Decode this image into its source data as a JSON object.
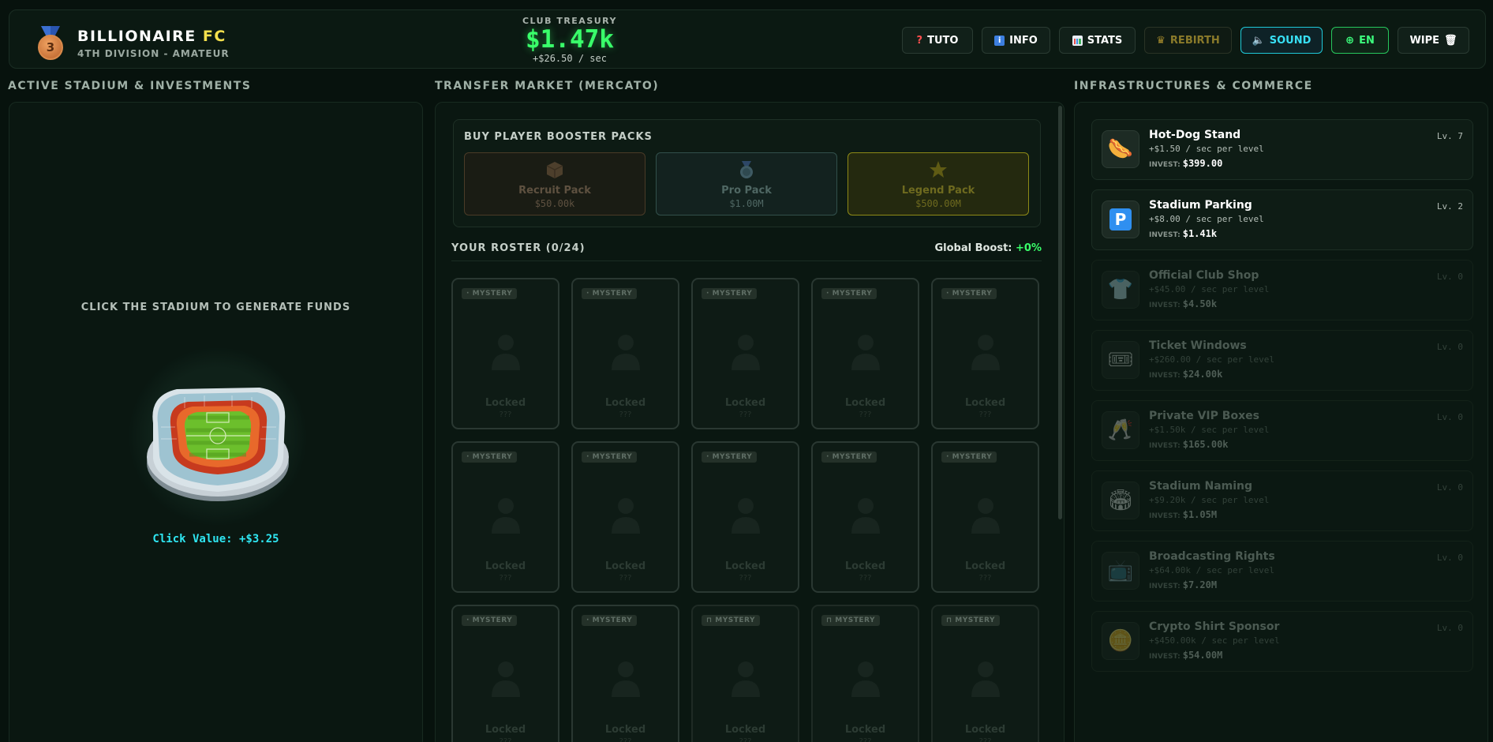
{
  "header": {
    "medal_number": "3",
    "title_part1": "BILLIONAIRE",
    "title_part2": "FC",
    "subtitle": "4TH DIVISION - AMATEUR",
    "treasury_label": "CLUB TREASURY",
    "treasury_value": "$1.47k",
    "treasury_rate": "+$26.50 / sec",
    "buttons": {
      "tuto": "TUTO",
      "info": "INFO",
      "stats": "STATS",
      "rebirth": "REBIRTH",
      "sound": "SOUND",
      "lang": "EN",
      "wipe": "WIPE"
    }
  },
  "left": {
    "section_title": "ACTIVE STADIUM & INVESTMENTS",
    "hint": "CLICK THE STADIUM TO GENERATE FUNDS",
    "click_value": "Click Value: +$3.25"
  },
  "middle": {
    "section_title": "TRANSFER MARKET (MERCATO)",
    "booster_title": "BUY PLAYER BOOSTER PACKS",
    "packs": [
      {
        "name": "Recruit Pack",
        "price": "$50.00k"
      },
      {
        "name": "Pro Pack",
        "price": "$1.00M"
      },
      {
        "name": "Legend Pack",
        "price": "$500.00M"
      }
    ],
    "roster_title": "YOUR ROSTER (0/24)",
    "global_boost_label": "Global Boost:",
    "global_boost_value": "+0%",
    "card_tag": "MYSTERY",
    "card_locked": "Locked",
    "card_sub": "???"
  },
  "right": {
    "section_title": "INFRASTRUCTURES & COMMERCE",
    "invest_label": "INVEST:",
    "items": [
      {
        "name": "Hot-Dog Stand",
        "rate": "+$1.50 / sec per level",
        "cost": "$399.00",
        "level": "Lv. 7",
        "icon": "hotdog-icon",
        "glyph": "🌭"
      },
      {
        "name": "Stadium Parking",
        "rate": "+$8.00 / sec per level",
        "cost": "$1.41k",
        "level": "Lv. 2",
        "icon": "parking-icon",
        "glyph": "P"
      },
      {
        "name": "Official Club Shop",
        "rate": "+$45.00 / sec per level",
        "cost": "$4.50k",
        "level": "Lv. 0",
        "icon": "shirt-icon",
        "glyph": "👕"
      },
      {
        "name": "Ticket Windows",
        "rate": "+$260.00 / sec per level",
        "cost": "$24.00k",
        "level": "Lv. 0",
        "icon": "ticket-icon",
        "glyph": "🎟"
      },
      {
        "name": "Private VIP Boxes",
        "rate": "+$1.50k / sec per level",
        "cost": "$165.00k",
        "level": "Lv. 0",
        "icon": "champagne-icon",
        "glyph": "🥂"
      },
      {
        "name": "Stadium Naming",
        "rate": "+$9.20k / sec per level",
        "cost": "$1.05M",
        "level": "Lv. 0",
        "icon": "stadium-sign-icon",
        "glyph": "🏟"
      },
      {
        "name": "Broadcasting Rights",
        "rate": "+$64.00k / sec per level",
        "cost": "$7.20M",
        "level": "Lv. 0",
        "icon": "tv-icon",
        "glyph": "📺"
      },
      {
        "name": "Crypto Shirt Sponsor",
        "rate": "+$450.00k / sec per level",
        "cost": "$54.00M",
        "level": "Lv. 0",
        "icon": "coin-icon",
        "glyph": "🪙"
      }
    ]
  },
  "colors": {
    "background": "#07120d",
    "money_green": "#39ff6a",
    "accent_cyan": "#2fe6f2",
    "title_yellow": "#f4e04d"
  }
}
